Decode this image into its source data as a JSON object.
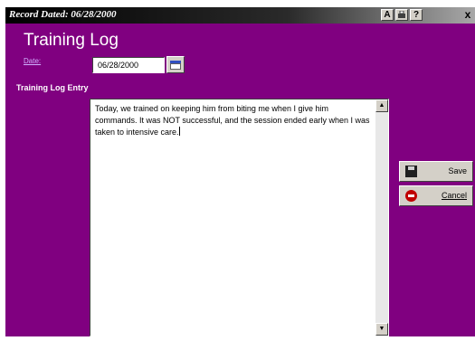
{
  "window": {
    "title": "Record Dated: 06/28/2000",
    "title_buttons": [
      "A",
      "?"
    ],
    "close_label": "x"
  },
  "form": {
    "page_title": "Training Log",
    "date_label": "Date:",
    "date_value": "06/28/2000",
    "entry_label": "Training Log Entry",
    "entry_text": "Today, we trained on keeping him from biting me when I give him commands.  It was NOT successful, and the session ended early when I was taken to intensive care."
  },
  "actions": {
    "save_label": "Save",
    "cancel_label": "Cancel"
  },
  "colors": {
    "background": "#800080",
    "button_face": "#d4d0c8"
  }
}
